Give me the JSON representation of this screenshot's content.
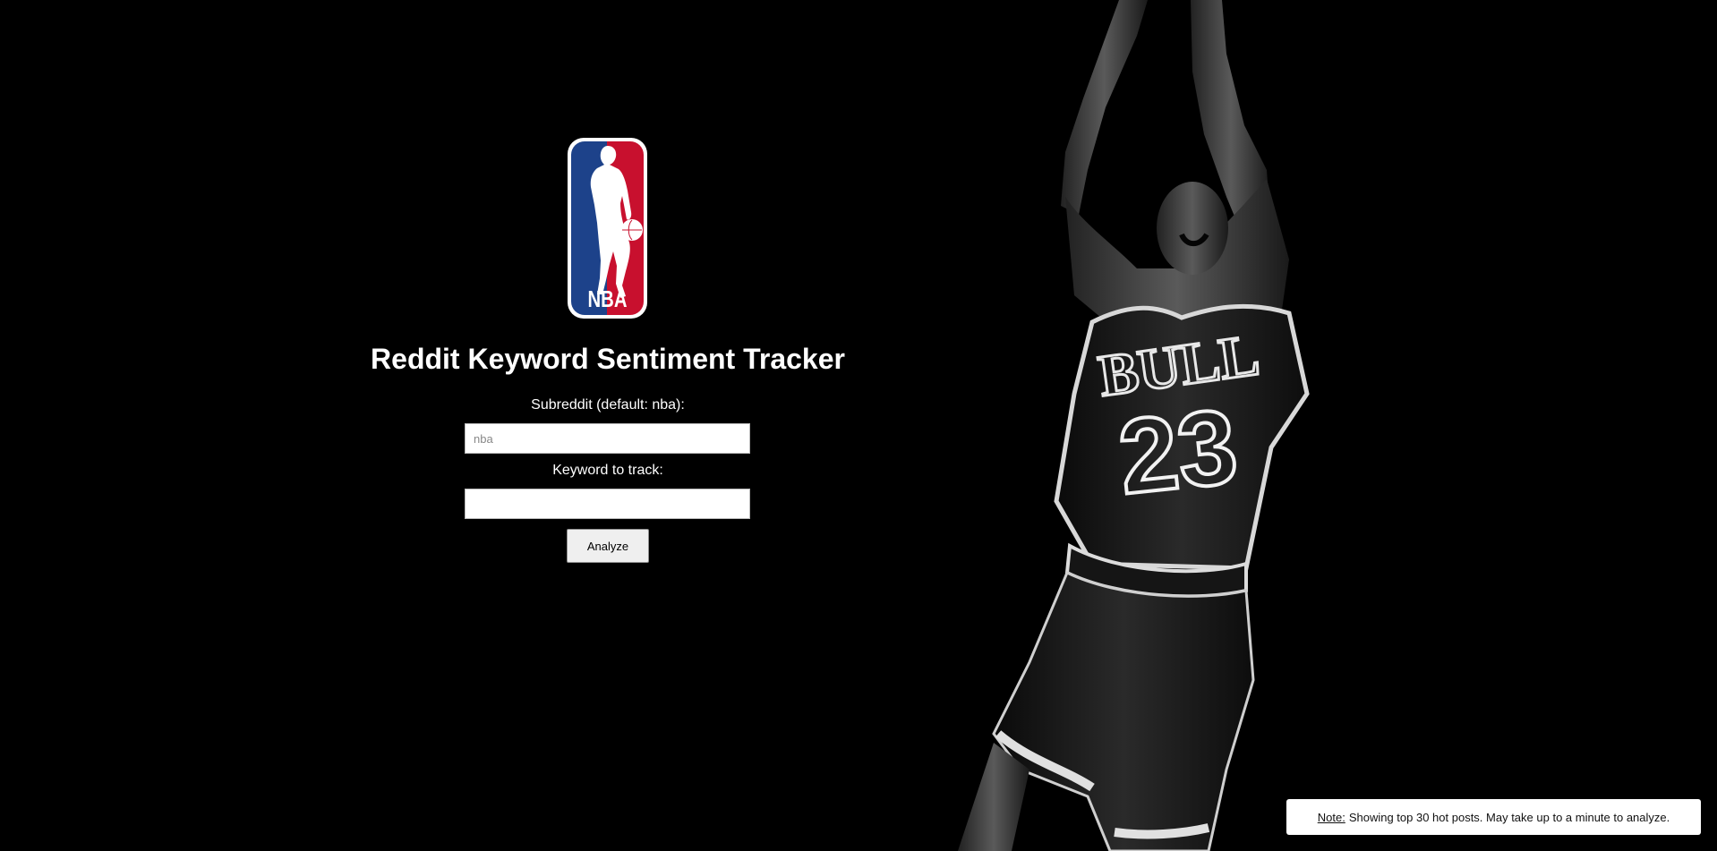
{
  "app": {
    "title": "Reddit Keyword Sentiment Tracker"
  },
  "logo": {
    "text": "NBA",
    "colors": {
      "blue": "#1d428a",
      "red": "#c8102e",
      "white": "#ffffff"
    }
  },
  "form": {
    "subreddit_label": "Subreddit (default: nba):",
    "subreddit_value": "",
    "subreddit_placeholder": "nba",
    "keyword_label": "Keyword to track:",
    "keyword_value": "",
    "keyword_placeholder": "",
    "submit_label": "Analyze"
  },
  "hero": {
    "jersey_text": "BULL",
    "jersey_number": "23"
  },
  "note": {
    "prefix": "Note:",
    "text": "Showing top 30 hot posts. May take up to a minute to analyze."
  }
}
